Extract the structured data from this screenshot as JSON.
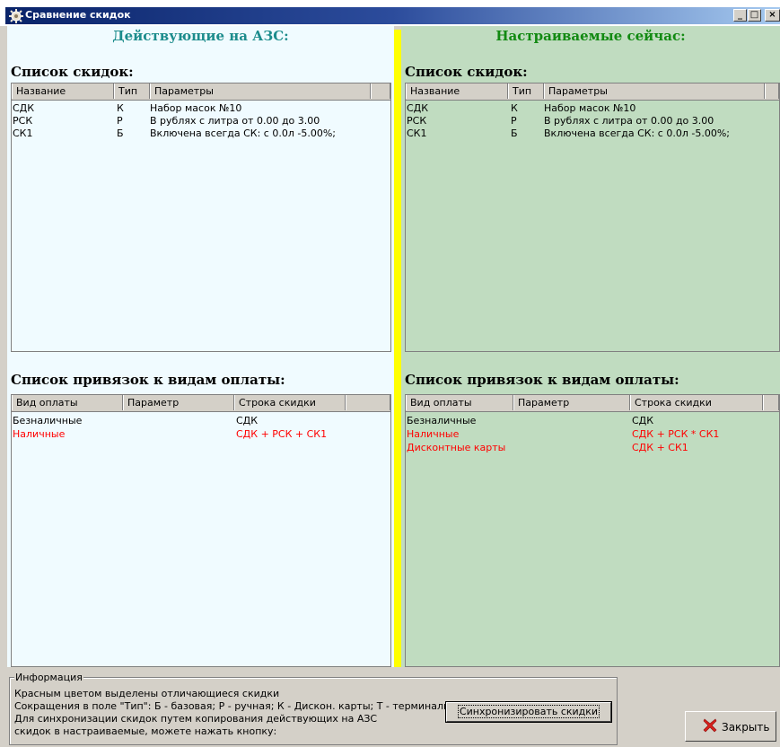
{
  "window": {
    "title": "Сравнение скидок",
    "controls": [
      "_",
      "□",
      "×"
    ]
  },
  "left_panel": {
    "heading": "Действующие на АЗС:",
    "discounts_title": "Список скидок:",
    "discount_columns": [
      "Название",
      "Тип",
      "Параметры"
    ],
    "discounts": [
      {
        "name": "СДК",
        "type": "К",
        "params": "Набор масок №10"
      },
      {
        "name": "РСК",
        "type": "Р",
        "params": "В рублях с литра от 0.00 до 3.00"
      },
      {
        "name": "СК1",
        "type": "Б",
        "params": "Включена всегда СК: с 0.0л -5.00%;"
      }
    ],
    "bindings_title": "Список привязок к видам оплаты:",
    "binding_columns": [
      "Вид оплаты",
      "Параметр",
      "Строка скидки"
    ],
    "bindings": [
      {
        "payment": "Безналичные",
        "param": "",
        "line": "СДК",
        "highlight": false
      },
      {
        "payment": "Наличные",
        "param": "",
        "line": "СДК + РСК + СК1",
        "highlight": true
      }
    ]
  },
  "right_panel": {
    "heading": "Настраиваемые сейчас:",
    "discounts_title": "Список скидок:",
    "discount_columns": [
      "Название",
      "Тип",
      "Параметры"
    ],
    "discounts": [
      {
        "name": "СДК",
        "type": "К",
        "params": "Набор масок №10"
      },
      {
        "name": "РСК",
        "type": "Р",
        "params": "В рублях с литра от 0.00 до 3.00"
      },
      {
        "name": "СК1",
        "type": "Б",
        "params": "Включена всегда СК: с 0.0л -5.00%;"
      }
    ],
    "bindings_title": "Список привязок к видам оплаты:",
    "binding_columns": [
      "Вид оплаты",
      "Параметр",
      "Строка скидки"
    ],
    "bindings": [
      {
        "payment": "Безналичные",
        "param": "",
        "line": "СДК",
        "highlight": false
      },
      {
        "payment": "Наличные",
        "param": "",
        "line": "СДК + РСК * СК1",
        "highlight": true
      },
      {
        "payment": "Дисконтные карты",
        "param": "",
        "line": "СДК + СК1",
        "highlight": true
      }
    ]
  },
  "info": {
    "legend": "Информация",
    "lines": [
      "Красным цветом выделены отличающиеся скидки",
      "Сокращения в поле \"Тип\": Б - базовая; Р - ручная; К - Дискон. карты; Т - терминальная",
      "Для синхронизации скидок путем копирования действующих на АЗС",
      "скидок в настраиваемые, можете нажать кнопку:"
    ]
  },
  "buttons": {
    "sync": "Синхронизировать скидки",
    "close": "Закрыть"
  },
  "icons": {
    "app": "gear-icon",
    "close": "red-x-icon"
  },
  "colors": {
    "left_bg": "#f0fbff",
    "right_bg": "#c0dcc0",
    "divider": "#ffff00",
    "left_heading": "#1c8c8c",
    "right_heading": "#128a12",
    "diff_highlight": "#ff0000"
  }
}
